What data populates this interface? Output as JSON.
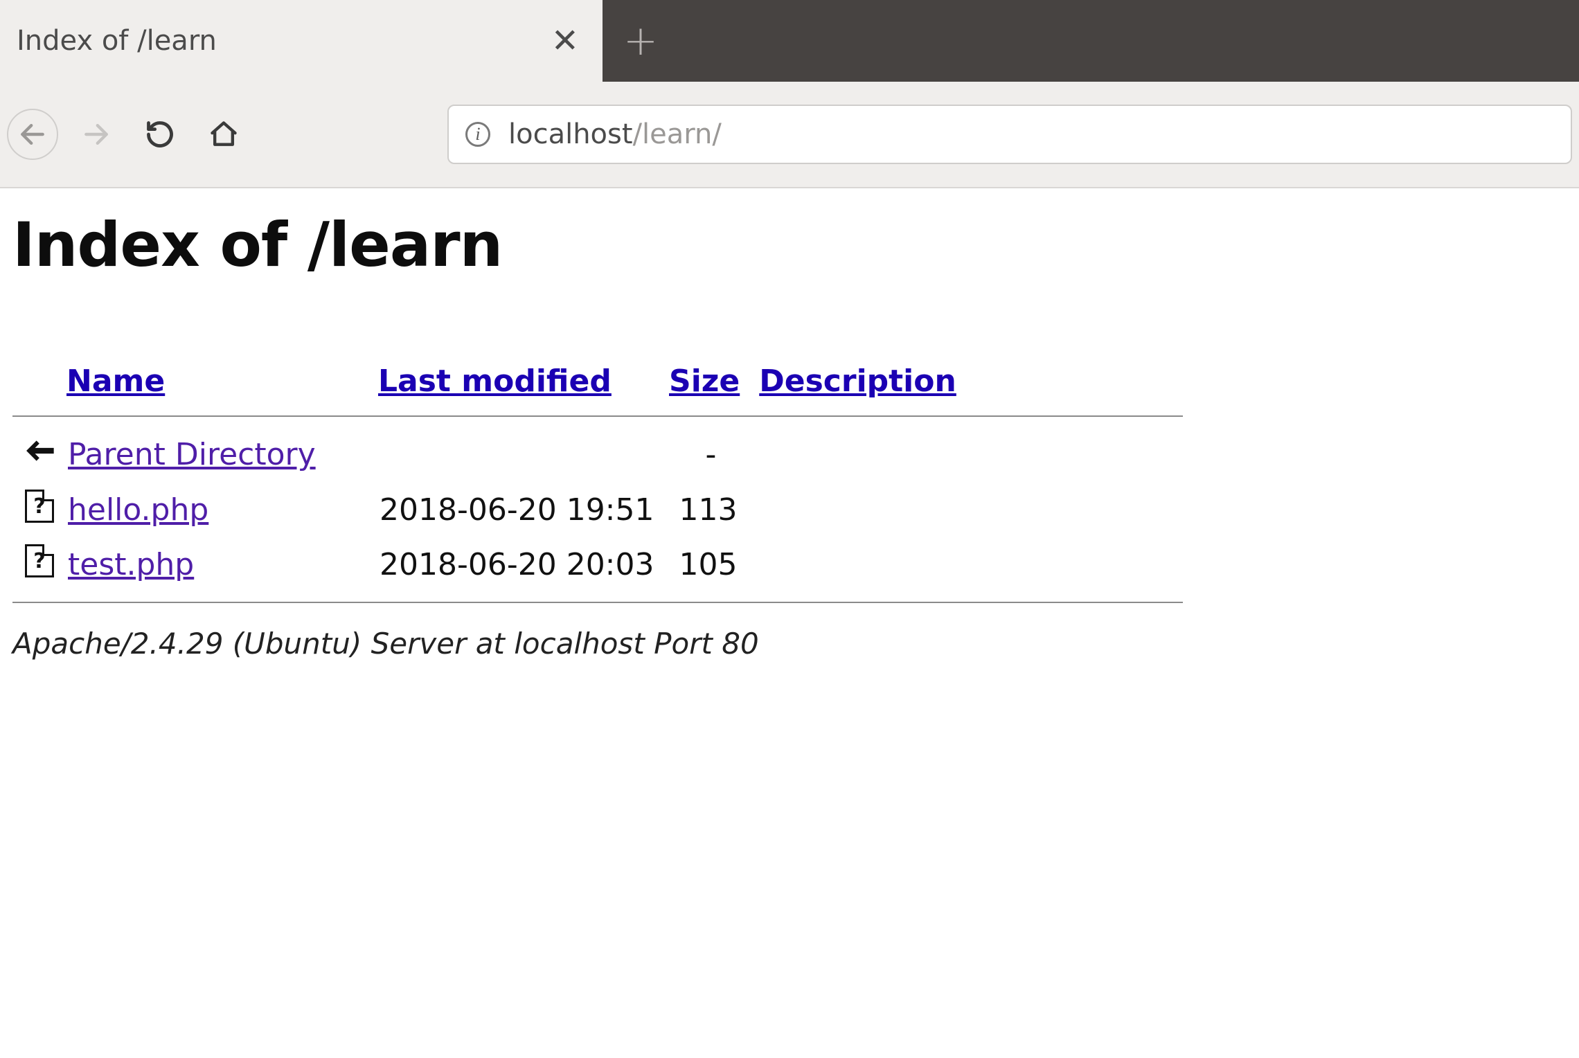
{
  "browser": {
    "tab_title": "Index of /learn",
    "url_host": "localhost",
    "url_path": "/learn/"
  },
  "page": {
    "heading": "Index of /learn",
    "columns": {
      "name": "Name",
      "last_modified": "Last modified",
      "size": "Size",
      "description": "Description"
    },
    "entries": [
      {
        "icon": "back",
        "name": "Parent Directory",
        "last_modified": "",
        "size": "-",
        "description": ""
      },
      {
        "icon": "unknown",
        "name": "hello.php",
        "last_modified": "2018-06-20 19:51",
        "size": "113",
        "description": ""
      },
      {
        "icon": "unknown",
        "name": "test.php",
        "last_modified": "2018-06-20 20:03",
        "size": "105",
        "description": ""
      }
    ],
    "server_signature": "Apache/2.4.29 (Ubuntu) Server at localhost Port 80"
  }
}
